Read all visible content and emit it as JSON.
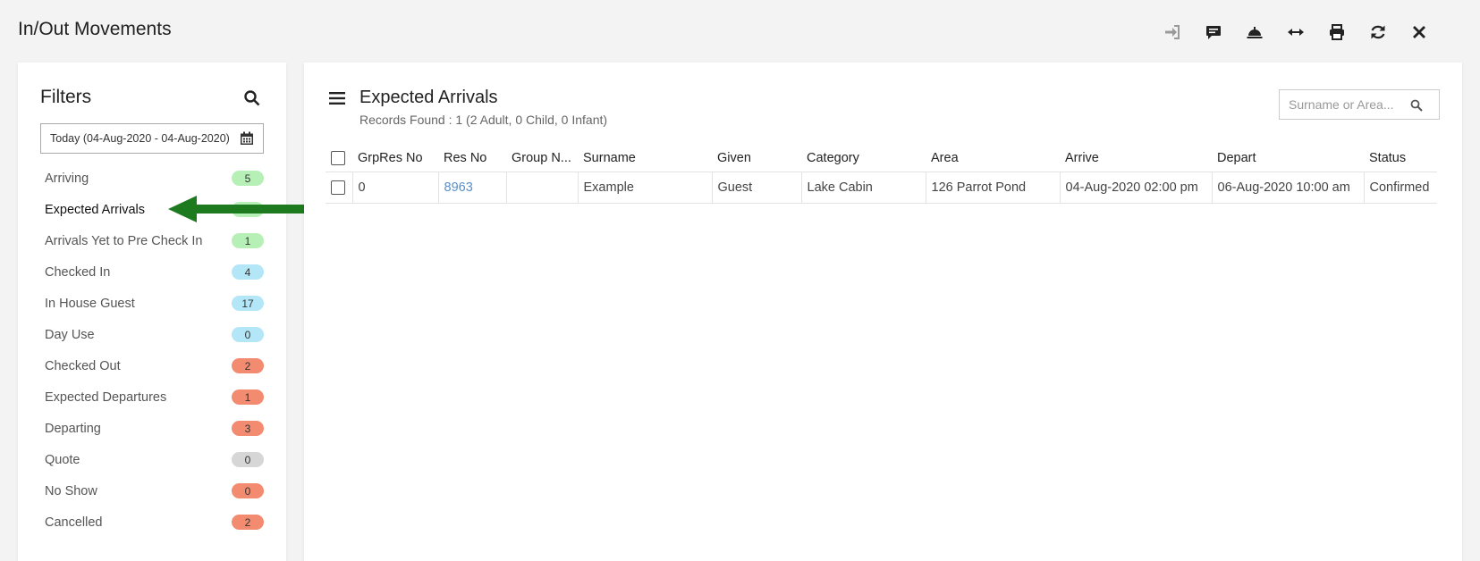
{
  "page": {
    "title": "In/Out Movements"
  },
  "toolbar": {
    "buttons": [
      {
        "name": "sign-in-icon"
      },
      {
        "name": "comment-icon"
      },
      {
        "name": "bell-icon"
      },
      {
        "name": "resize-horizontal-icon"
      },
      {
        "name": "print-icon"
      },
      {
        "name": "refresh-icon"
      },
      {
        "name": "close-icon"
      }
    ]
  },
  "filters": {
    "title": "Filters",
    "date_range": "Today (04-Aug-2020 - 04-Aug-2020)",
    "items": [
      {
        "label": "Arriving",
        "count": "5",
        "color": "green"
      },
      {
        "label": "Expected Arrivals",
        "count": "",
        "color": "green"
      },
      {
        "label": "Arrivals Yet to Pre Check In",
        "count": "1",
        "color": "green"
      },
      {
        "label": "Checked In",
        "count": "4",
        "color": "blue"
      },
      {
        "label": "In House Guest",
        "count": "17",
        "color": "blue"
      },
      {
        "label": "Day Use",
        "count": "0",
        "color": "blue"
      },
      {
        "label": "Checked Out",
        "count": "2",
        "color": "red"
      },
      {
        "label": "Expected Departures",
        "count": "1",
        "color": "red"
      },
      {
        "label": "Departing",
        "count": "3",
        "color": "red"
      },
      {
        "label": "Quote",
        "count": "0",
        "color": "grey"
      },
      {
        "label": "No Show",
        "count": "0",
        "color": "red"
      },
      {
        "label": "Cancelled",
        "count": "2",
        "color": "red"
      }
    ]
  },
  "main": {
    "title": "Expected Arrivals",
    "records": "Records Found : 1 (2 Adult, 0 Child, 0 Infant)",
    "search_placeholder": "Surname or Area...",
    "columns": [
      "GrpRes No",
      "Res No",
      "Group N...",
      "Surname",
      "Given",
      "Category",
      "Area",
      "Arrive",
      "Depart",
      "Status"
    ],
    "rows": [
      {
        "grpres_no": "0",
        "res_no": "8963",
        "group_name": "",
        "surname": "Example",
        "given": "Guest",
        "category": "Lake Cabin",
        "area": "126 Parrot Pond",
        "arrive": "04-Aug-2020 02:00 pm",
        "depart": "06-Aug-2020 10:00 am",
        "status": "Confirmed"
      }
    ]
  },
  "colors": {
    "arrow": "#1e7a1e",
    "badge_green": "#b7f0b7",
    "badge_blue": "#b3e6f7",
    "badge_red": "#f28b70",
    "badge_grey": "#d6d6d6",
    "link": "#5b8fc4"
  }
}
